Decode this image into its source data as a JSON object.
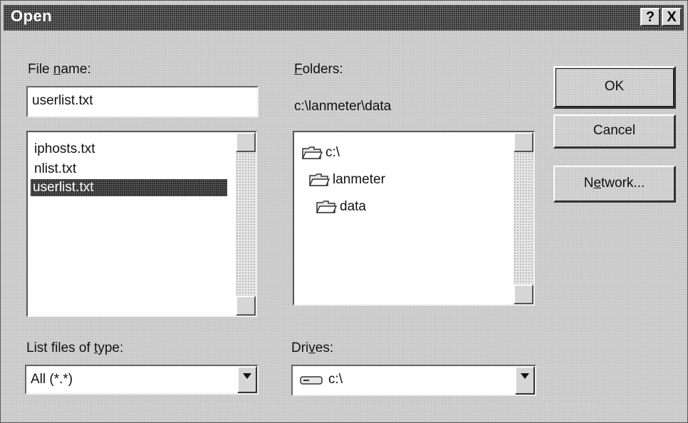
{
  "window": {
    "title": "Open",
    "help_label": "?",
    "close_label": "X"
  },
  "file_name": {
    "label": "File name:",
    "label_prefix": "File ",
    "label_accel": "n",
    "label_suffix": "ame:",
    "value": "userlist.txt"
  },
  "file_list": {
    "items": [
      "iphosts.txt",
      "nlist.txt",
      "userlist.txt"
    ],
    "selected": "userlist.txt"
  },
  "folders": {
    "label_accel": "F",
    "label_suffix": "olders:",
    "current_path": "c:\\lanmeter\\data",
    "items": [
      {
        "name": "c:\\",
        "icon": "open-folder-icon"
      },
      {
        "name": "lanmeter",
        "icon": "open-folder-icon"
      },
      {
        "name": "data",
        "icon": "open-folder-icon"
      }
    ]
  },
  "buttons": {
    "ok": "OK",
    "cancel": "Cancel",
    "network_prefix": "N",
    "network_accel": "e",
    "network_suffix": "twork..."
  },
  "file_type": {
    "label_prefix": "List files of ",
    "label_accel": "t",
    "label_suffix": "ype:",
    "value": "All (*.*)"
  },
  "drives": {
    "label_prefix": "Dri",
    "label_accel": "v",
    "label_suffix": "es:",
    "value": "c:\\",
    "icon": "drive-icon"
  }
}
